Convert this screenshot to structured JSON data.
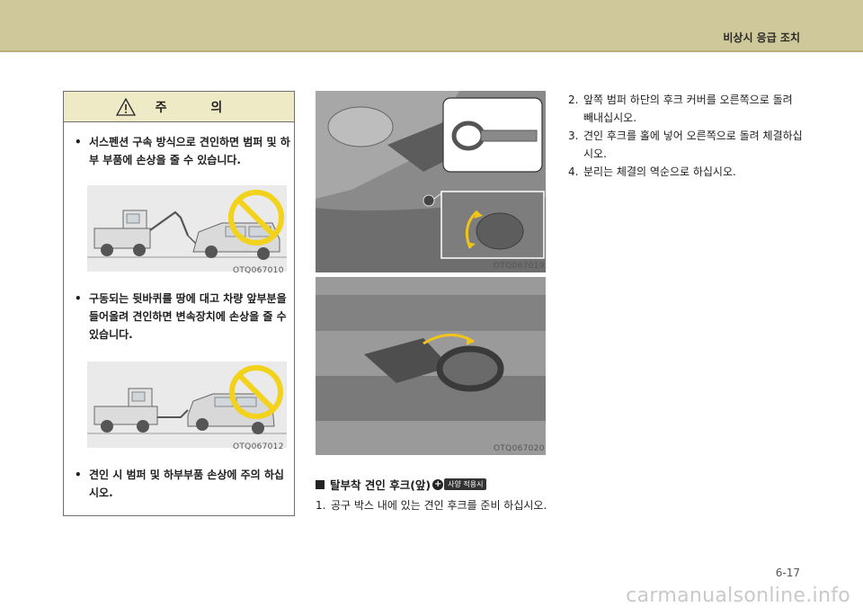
{
  "header": {
    "section_title": "비상시 응급 조치"
  },
  "caution": {
    "title": "주  의",
    "bullets": [
      "서스펜션 구속 방식으로 견인하면 범퍼 및 하부 부품에 손상을 줄 수 있습니다.",
      "구동되는 뒷바퀴를 땅에 대고 차량 앞부분을 들어올려 견인하면 변속장치에 손상을 줄 수 있습니다.",
      "견인 시 범퍼 및 하부부품 손상에 주의 하십시오."
    ],
    "bullet_symbol": "•",
    "figures": [
      {
        "code": "OTQ067010"
      },
      {
        "code": "OTQ067012"
      }
    ]
  },
  "photos": [
    {
      "code": "OTQ067019"
    },
    {
      "code": "OTQ067020"
    }
  ],
  "tow_hook": {
    "heading": "탈부착 견인 후크(앞)",
    "badge_symbol": "+",
    "badge_label": "사양 적용시",
    "steps": [
      {
        "num": "1.",
        "text": "공구 박스 내에 있는 견인 후크를 준비 하십시오."
      },
      {
        "num": "2.",
        "text": "앞쪽 범퍼 하단의 후크 커버를 오른쪽으로 돌려 빼내십시오."
      },
      {
        "num": "3.",
        "text": "견인 후크를 홀에 넣어 오른쪽으로 돌려 체결하십시오."
      },
      {
        "num": "4.",
        "text": "분리는 체결의 역순으로 하십시오."
      }
    ]
  },
  "footer": {
    "page_number": "6-17",
    "watermark": "carmanualsonline.info"
  },
  "colors": {
    "header_band": "#cfc89a",
    "caution_header": "#efeac6",
    "prohibition": "#f2d21a"
  }
}
